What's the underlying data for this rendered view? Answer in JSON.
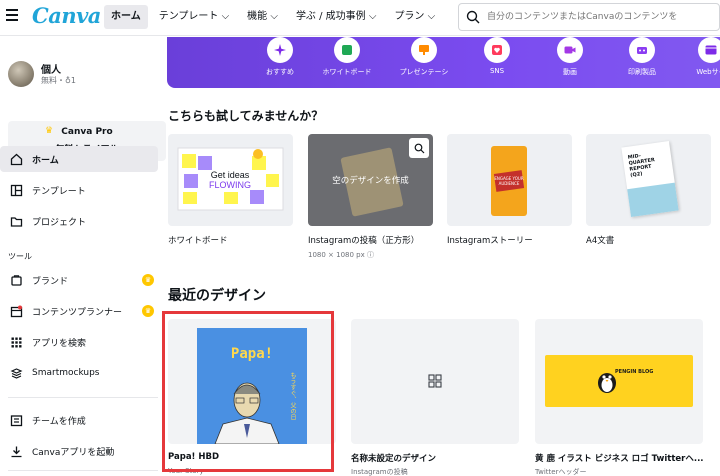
{
  "header": {
    "logo": "Canva",
    "nav": [
      {
        "label": "ホーム",
        "active": true
      },
      {
        "label": "テンプレート ⌵",
        "active": false
      },
      {
        "label": "機能 ⌵",
        "active": false
      },
      {
        "label": "学ぶ / 成功事例 ⌵",
        "active": false
      },
      {
        "label": "プラン ⌵",
        "active": false
      }
    ],
    "search_placeholder": "自分のコンテンツまたはCanvaのコンテンツを"
  },
  "sidebar": {
    "profile_name": "個人",
    "profile_sub": "無料・♁1",
    "trial_line1": "Canva Pro",
    "trial_line2": "無料トライアル",
    "items_top": [
      {
        "label": "ホーム",
        "icon": "home-icon",
        "active": true
      },
      {
        "label": "テンプレート",
        "icon": "template-icon",
        "active": false
      },
      {
        "label": "プロジェクト",
        "icon": "folder-icon",
        "active": false
      }
    ],
    "tools_label": "ツール",
    "tools": [
      {
        "label": "ブランド",
        "icon": "brand-icon",
        "pro": true
      },
      {
        "label": "コンテンツプランナー",
        "icon": "calendar-icon",
        "pro": true
      },
      {
        "label": "アプリを検索",
        "icon": "apps-icon",
        "pro": false
      },
      {
        "label": "Smartmockups",
        "icon": "mockup-icon",
        "pro": false
      }
    ],
    "bottom": [
      {
        "label": "チームを作成",
        "icon": "team-icon"
      },
      {
        "label": "Canvaアプリを起動",
        "icon": "download-icon"
      }
    ]
  },
  "categories": [
    {
      "label": "おすすめ",
      "icon": "sparkle-icon",
      "color": "#7d2ae8"
    },
    {
      "label": "ホワイトボード",
      "icon": "whiteboard-icon",
      "color": "#1fa855"
    },
    {
      "label": "プレゼンテーシ",
      "icon": "presentation-icon",
      "color": "#ff8b00"
    },
    {
      "label": "SNS",
      "icon": "heart-icon",
      "color": "#ff3b5c"
    },
    {
      "label": "動画",
      "icon": "video-icon",
      "color": "#a338e6"
    },
    {
      "label": "印刷製品",
      "icon": "print-icon",
      "color": "#8b3df2"
    },
    {
      "label": "Webサイ",
      "icon": "web-icon",
      "color": "#7d2ae8"
    }
  ],
  "try_section": {
    "title": "こちらも試してみませんか？",
    "cards": [
      {
        "title": "ホワイトボード",
        "sub": "",
        "thumb_text": "Get ideas FLOWING"
      },
      {
        "title": "Instagramの投稿（正方形）",
        "sub": "1080 × 1080 px ⓘ",
        "thumb_text": "空のデザインを作成"
      },
      {
        "title": "Instagramストーリー",
        "sub": "",
        "thumb_text": "ENGAGE YOUR AUDIENCE"
      },
      {
        "title": "A4文書",
        "sub": "",
        "thumb_text": "MID-QUARTER REPORT (Q2)"
      }
    ]
  },
  "recent_section": {
    "title": "最近のデザイン",
    "cards": [
      {
        "title": "Papa! HBD",
        "sub": "Your Story",
        "thumb_text": "Papa!",
        "thumb_sub": "もうすぐ、父の日"
      },
      {
        "title": "名称未設定のデザイン",
        "sub": "Instagramの投稿",
        "thumb_text": ""
      },
      {
        "title": "黄 鹿 イラスト ビジネス ロゴ Twitterヘ...",
        "sub": "Twitterヘッダー",
        "thumb_text": "PENGIN BLOG"
      }
    ]
  }
}
